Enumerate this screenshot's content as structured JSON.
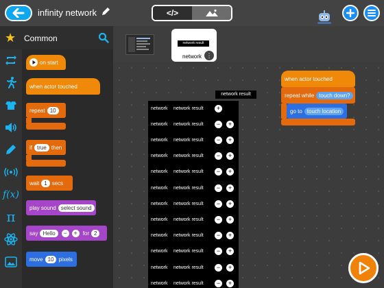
{
  "header": {
    "title": "infinity network",
    "code_mode_label": "</>"
  },
  "palette": {
    "category": "Common",
    "blocks": {
      "on_start": "on start",
      "when_actor_touched": "when actor touched",
      "repeat": "repeat",
      "repeat_count": "10",
      "if": "if",
      "if_value": "true",
      "then": "then",
      "wait": "wait",
      "wait_value": "1",
      "secs": "secs",
      "play_sound": "play sound",
      "select_sound": "select sound",
      "say": "say",
      "say_value": "Hello",
      "say_for": "for",
      "say_secs": "2",
      "move": "move",
      "move_value": "10",
      "pixels": "pixels"
    }
  },
  "thumbnails": {
    "screen_label": "network result",
    "actor_name": "network",
    "menu_glyph": "⋮"
  },
  "canvas": {
    "tooltip": "network result",
    "row_label": "network",
    "row_value": "network result",
    "row_count": 12,
    "script": {
      "hat": "when actor touched",
      "repeat_while": "repeat while",
      "condition": "touch down?",
      "go_to": "go to",
      "target": "touch location"
    }
  },
  "colors": {
    "accent_blue": "#1a8ef5",
    "event_orange": "#f0880a",
    "control_orange": "#e36a0d",
    "sound_purple": "#a546c9",
    "motion_blue": "#2d6ee0"
  },
  "icons": [
    "back-arrow-icon",
    "pencil-icon",
    "code-icon",
    "image-icon",
    "robot-icon",
    "add-icon",
    "menu-icon",
    "star-icon",
    "search-icon",
    "play-icon"
  ]
}
